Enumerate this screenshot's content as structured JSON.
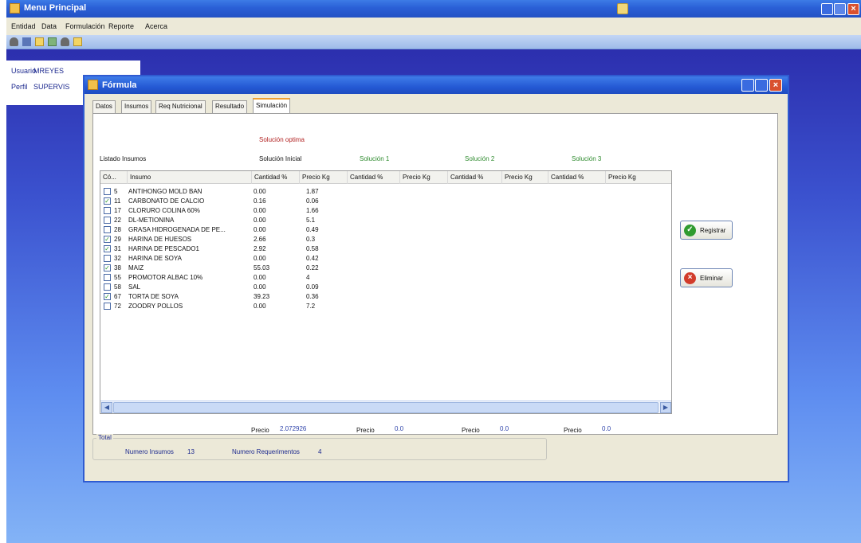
{
  "main_window": {
    "title": "Menu Principal",
    "menu": [
      "Entidad",
      "Data",
      "Formulación",
      "Reporte",
      "Acerca"
    ]
  },
  "user_panel": {
    "usuario_label": "Usuario",
    "usuario_value": "MREYES",
    "perfil_label": "Perfil",
    "perfil_value": "SUPERVIS"
  },
  "formula": {
    "title": "Fórmula",
    "tabs": [
      "Datos",
      "Insumos",
      "Req Nutricional",
      "Resultado",
      "Simulación"
    ],
    "active_tab": "Simulación",
    "solucion_optima": "Solución optima",
    "listado_insumos": "Listado Insumos",
    "solutions": [
      "Solución Inicial",
      "Solución 1",
      "Solución 2",
      "Solución 3"
    ],
    "columns": [
      "Có...",
      "Insumo",
      "Cantidad %",
      "Precio Kg",
      "Cantidad %",
      "Precio Kg",
      "Cantidad %",
      "Precio Kg",
      "Cantidad %",
      "Precio Kg"
    ],
    "rows": [
      {
        "checked": false,
        "code": "5",
        "name": "ANTIHONGO MOLD BAN",
        "qty": "0.00",
        "price": "1.87"
      },
      {
        "checked": true,
        "code": "11",
        "name": "CARBONATO DE CALCIO",
        "qty": "0.16",
        "price": "0.06"
      },
      {
        "checked": false,
        "code": "17",
        "name": "CLORURO COLINA 60%",
        "qty": "0.00",
        "price": "1.66"
      },
      {
        "checked": false,
        "code": "22",
        "name": "DL-METIONINA",
        "qty": "0.00",
        "price": "5.1"
      },
      {
        "checked": false,
        "code": "28",
        "name": "GRASA HIDROGENADA DE PE...",
        "qty": "0.00",
        "price": "0.49"
      },
      {
        "checked": true,
        "code": "29",
        "name": "HARINA DE HUESOS",
        "qty": "2.66",
        "price": "0.3"
      },
      {
        "checked": true,
        "code": "31",
        "name": "HARINA DE PESCADO1",
        "qty": "2.92",
        "price": "0.58"
      },
      {
        "checked": false,
        "code": "32",
        "name": "HARINA DE SOYA",
        "qty": "0.00",
        "price": "0.42"
      },
      {
        "checked": true,
        "code": "38",
        "name": "MAIZ",
        "qty": "55.03",
        "price": "0.22"
      },
      {
        "checked": false,
        "code": "55",
        "name": "PROMOTOR ALBAC 10%",
        "qty": "0.00",
        "price": "4"
      },
      {
        "checked": false,
        "code": "58",
        "name": "SAL",
        "qty": "0.00",
        "price": "0.09"
      },
      {
        "checked": true,
        "code": "67",
        "name": "TORTA DE SOYA",
        "qty": "39.23",
        "price": "0.36"
      },
      {
        "checked": false,
        "code": "72",
        "name": "ZOODRY POLLOS",
        "qty": "0.00",
        "price": "7.2"
      }
    ],
    "buttons": {
      "register": "Registrar",
      "delete": "Eliminar"
    },
    "prices": [
      {
        "label": "Precio",
        "value": "2.072926"
      },
      {
        "label": "Precio",
        "value": "0.0"
      },
      {
        "label": "Precio",
        "value": "0.0"
      },
      {
        "label": "Precio",
        "value": "0.0"
      }
    ],
    "total": {
      "legend": "Total",
      "insumos_label": "Numero Insumos",
      "insumos_value": "13",
      "req_label": "Numero Requerimentos",
      "req_value": "4"
    }
  }
}
